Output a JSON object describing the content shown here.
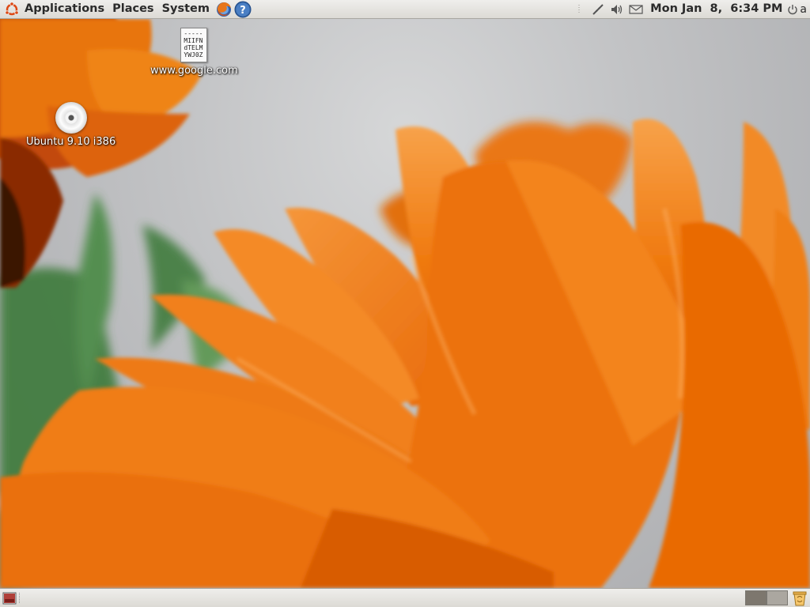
{
  "top_panel": {
    "menus": [
      "Applications",
      "Places",
      "System"
    ],
    "launchers": {
      "browser": "firefox-icon",
      "help": "help-icon"
    },
    "tray_icons": [
      "network-icon",
      "volume-icon",
      "mail-icon"
    ],
    "clock": "Mon Jan  8,  6:34 PM",
    "user": "a"
  },
  "desktop": {
    "icons": [
      {
        "label": "www.google.com",
        "kind": "text-file-icon",
        "preview": "-----\nMIIFN\ndTELM\nYWJ0Z"
      },
      {
        "label": "Ubuntu 9.10 i386",
        "kind": "cd-icon"
      }
    ]
  },
  "bottom_panel": {
    "workspaces": 2,
    "active_workspace": 1
  },
  "colors": {
    "panel": "#dcdad5",
    "petal": "#f07a10",
    "wallpaper_gray": "#c2c3c5"
  }
}
